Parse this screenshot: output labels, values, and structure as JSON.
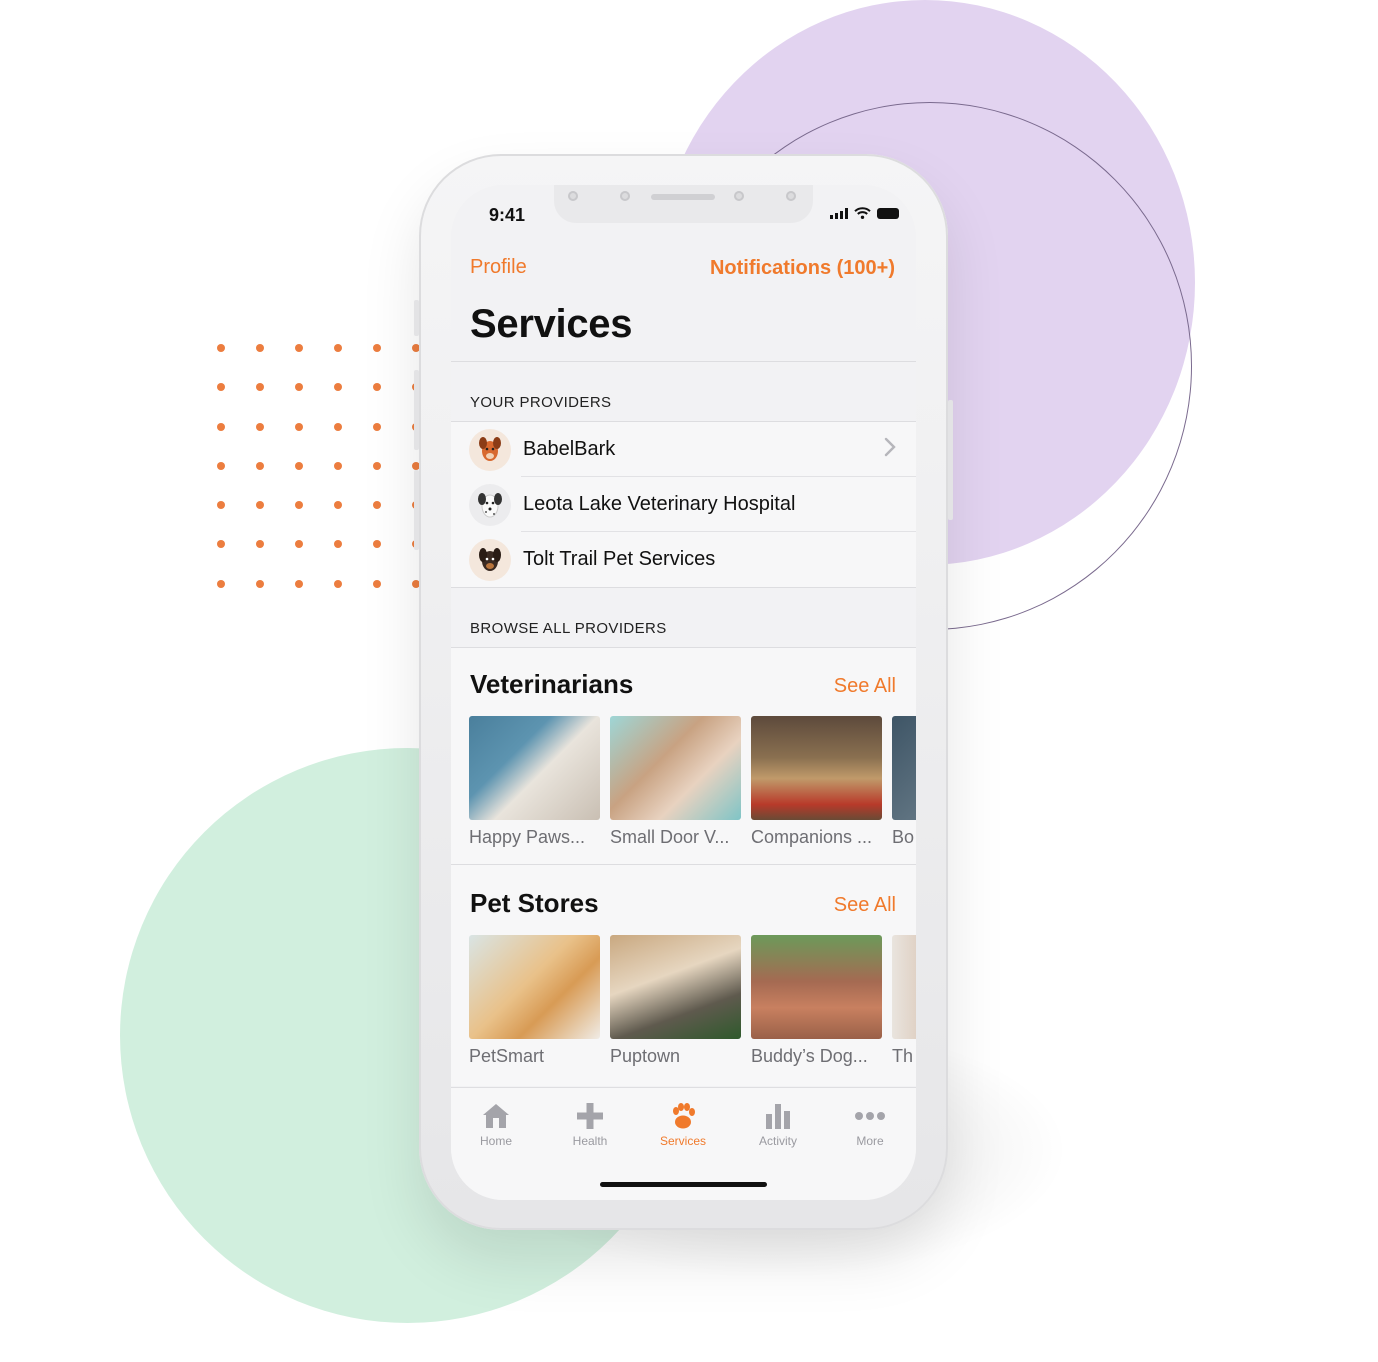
{
  "status_bar": {
    "time": "9:41"
  },
  "nav": {
    "left": "Profile",
    "right": "Notifications (100+)"
  },
  "page_title": "Services",
  "your_providers": {
    "header": "YOUR PROVIDERS",
    "items": [
      {
        "label": "BabelBark",
        "icon": "dog-avatar-icon",
        "has_chevron": true
      },
      {
        "label": "Leota Lake Veterinary Hospital",
        "icon": "dalmatian-avatar-icon"
      },
      {
        "label": "Tolt Trail Pet Services",
        "icon": "dachshund-avatar-icon"
      }
    ]
  },
  "browse": {
    "header": "BROWSE ALL PROVIDERS",
    "categories": [
      {
        "title": "Veterinarians",
        "see_all": "See All",
        "items": [
          "Happy Paws...",
          "Small Door V...",
          "Companions ...",
          "Bo"
        ]
      },
      {
        "title": "Pet Stores",
        "see_all": "See All",
        "items": [
          "PetSmart",
          "Puptown",
          "Buddy’s Dog...",
          "Th"
        ]
      }
    ]
  },
  "tabbar": {
    "tabs": [
      {
        "label": "Home",
        "icon": "home-icon"
      },
      {
        "label": "Health",
        "icon": "plus-icon"
      },
      {
        "label": "Services",
        "icon": "paw-icon",
        "active": true
      },
      {
        "label": "Activity",
        "icon": "bar-chart-icon"
      },
      {
        "label": "More",
        "icon": "more-icon"
      }
    ]
  },
  "colors": {
    "accent": "#f07a2c",
    "purple_circle": "#e2d3f0",
    "green_circle": "#d1efde",
    "dots": "#ec7d3f"
  }
}
